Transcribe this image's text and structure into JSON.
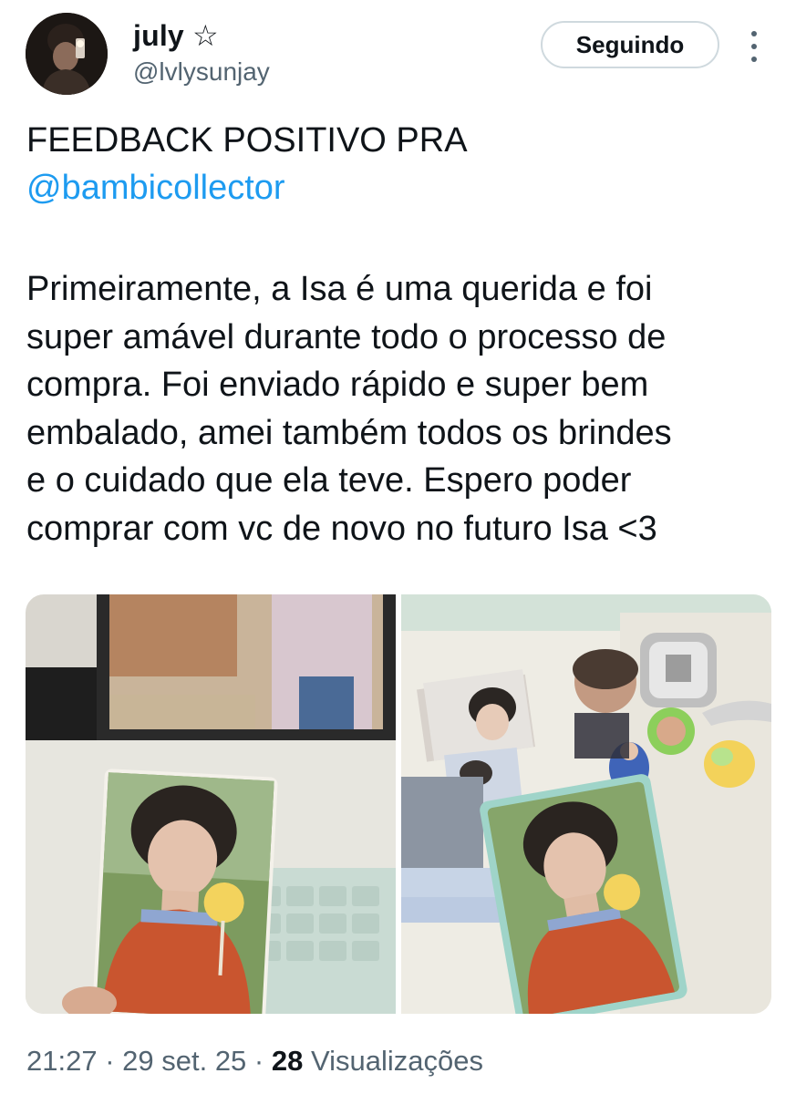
{
  "user": {
    "display_name": "july ☆",
    "handle": "@lvlysunjay",
    "avatar_icon": "avatar"
  },
  "actions": {
    "follow_label": "Seguindo",
    "more_icon": "more-vertical-icon"
  },
  "tweet": {
    "line1": "FEEDBACK POSITIVO PRA",
    "mention": "@bambicollector",
    "paragraph_lines": [
      "Primeiramente, a Isa é uma querida e foi",
      "super amável durante todo o processo de",
      "compra. Foi enviado rápido e super bem",
      "embalado, amei também todos os brindes",
      "e o cuidado que ela teve. Espero poder",
      "comprar com vc de novo no futuro Isa <3"
    ]
  },
  "media": {
    "photos": [
      "photocard-with-laptop-photo",
      "photocard-with-stickers-photo"
    ]
  },
  "footer": {
    "time": "21:27",
    "sep1": " · ",
    "date": "29 set. 25",
    "sep2": " · ",
    "views_count": "28",
    "views_label": " Visualizações"
  },
  "colors": {
    "link": "#1d9bf0",
    "secondary_text": "#536471",
    "primary_text": "#0f1419",
    "button_border": "#cfd9de"
  }
}
